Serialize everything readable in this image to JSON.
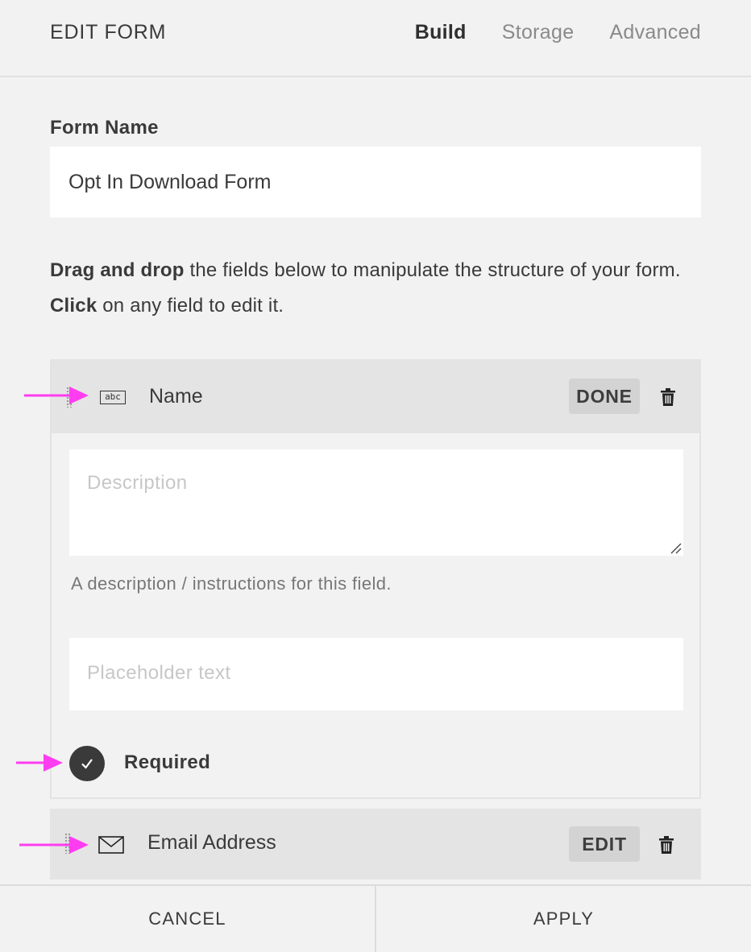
{
  "header": {
    "title": "EDIT FORM",
    "tabs": [
      {
        "label": "Build",
        "active": true
      },
      {
        "label": "Storage",
        "active": false
      },
      {
        "label": "Advanced",
        "active": false
      }
    ]
  },
  "form_name": {
    "label": "Form Name",
    "value": "Opt In Download Form"
  },
  "instructions": {
    "bold1": "Drag and drop",
    "text1": " the fields below to manipulate the structure of your form. ",
    "bold2": "Click",
    "text2": " on any field to edit it."
  },
  "fields": [
    {
      "icon": "text-field-icon",
      "icon_text": "abc",
      "title": "Name",
      "action_label": "DONE",
      "expanded": true,
      "description_placeholder": "Description",
      "description_help": "A description / instructions for this field.",
      "placeholder_placeholder": "Placeholder text",
      "required_label": "Required",
      "required": true
    },
    {
      "icon": "envelope-icon",
      "title": "Email Address",
      "action_label": "EDIT",
      "expanded": false
    }
  ],
  "footer": {
    "cancel_label": "CANCEL",
    "apply_label": "APPLY"
  },
  "colors": {
    "background": "#f2f2f2",
    "field_header": "#e4e4e4",
    "annotation_arrow": "#ff3df0",
    "check_fill": "#3a3a3a"
  }
}
